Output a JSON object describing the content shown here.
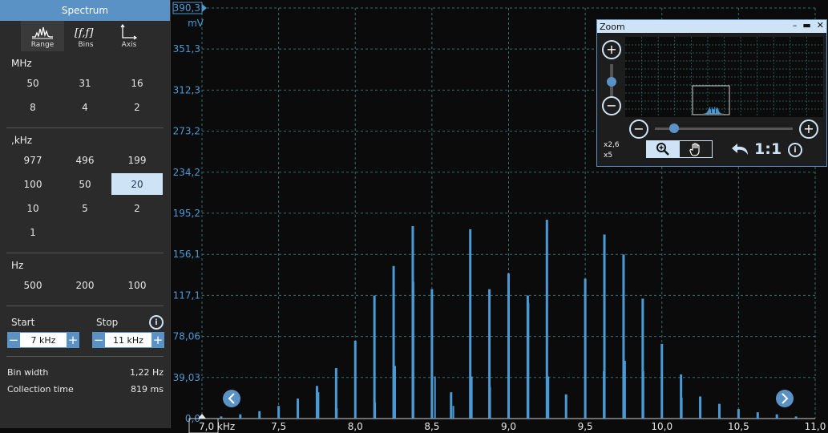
{
  "sidebar": {
    "title": "Spectrum",
    "tabs": [
      {
        "label": "Range",
        "icon": "spectrum-range-icon"
      },
      {
        "label": "Bins",
        "icon": "bins-icon"
      },
      {
        "label": "Axis",
        "icon": "axis-icon"
      }
    ],
    "sections": [
      {
        "label": "MHz",
        "values": [
          "50",
          "31",
          "16",
          "8",
          "4",
          "2"
        ]
      },
      {
        "label": ",kHz",
        "values": [
          "977",
          "496",
          "199",
          "100",
          "50",
          "20",
          "10",
          "5",
          "2",
          "1"
        ],
        "selected": "20"
      },
      {
        "label": "Hz",
        "values": [
          "500",
          "200",
          "100"
        ]
      }
    ],
    "start_label": "Start",
    "stop_label": "Stop",
    "start_value": "7 kHz",
    "stop_value": "11 kHz",
    "minus": "−",
    "plus": "+",
    "bin_width_label": "Bin width",
    "bin_width_value": "1,22 Hz",
    "collection_label": "Collection time",
    "collection_value": "819 ms"
  },
  "zoom": {
    "title": "Zoom",
    "x_factor": "x2,6",
    "y_factor": "x5",
    "ratio_label": "1:1",
    "info": "i"
  },
  "colors": {
    "accent": "#5b92c5",
    "selected_bg": "#cfe3f7",
    "grid": "#2f6f70",
    "trace": "#4a9ad6"
  },
  "chart_data": {
    "type": "bar",
    "ylabel": "mV",
    "xlabel": "kHz",
    "ylim": [
      0,
      390.3
    ],
    "xlim": [
      7.0,
      11.0
    ],
    "y_ticks": [
      "390,3",
      "351,3",
      "312,3",
      "273,2",
      "234,2",
      "195,2",
      "156,1",
      "117,1",
      "78,06",
      "39,03",
      "0,0"
    ],
    "y_tick_values": [
      390.3,
      351.3,
      312.3,
      273.2,
      234.2,
      195.2,
      156.1,
      117.1,
      78.06,
      39.03,
      0
    ],
    "x_ticks": [
      "7,0 kHz",
      "7,5",
      "8,0",
      "8,5",
      "9,0",
      "9,5",
      "10,0",
      "10,5",
      "11,0"
    ],
    "x_tick_values": [
      7.0,
      7.5,
      8.0,
      8.5,
      9.0,
      9.5,
      10.0,
      10.5,
      11.0
    ],
    "series": [
      {
        "values": [
          [
            7.125,
            2
          ],
          [
            7.25,
            4
          ],
          [
            7.375,
            7
          ],
          [
            7.5,
            12
          ],
          [
            7.625,
            19
          ],
          [
            7.75,
            31
          ],
          [
            7.875,
            48
          ],
          [
            8.0,
            74
          ],
          [
            8.125,
            117
          ],
          [
            8.25,
            145
          ],
          [
            8.375,
            183
          ],
          [
            8.5,
            123
          ],
          [
            8.625,
            25
          ],
          [
            8.75,
            180
          ],
          [
            8.875,
            123
          ],
          [
            9.0,
            138
          ],
          [
            9.125,
            117
          ],
          [
            9.25,
            189
          ],
          [
            9.375,
            23
          ],
          [
            9.5,
            133
          ],
          [
            9.625,
            175
          ],
          [
            9.75,
            156
          ],
          [
            9.875,
            114
          ],
          [
            10.0,
            71
          ],
          [
            10.125,
            42
          ],
          [
            10.25,
            21
          ],
          [
            10.375,
            14
          ],
          [
            10.5,
            9
          ],
          [
            10.625,
            6
          ],
          [
            10.75,
            4
          ],
          [
            10.875,
            2
          ]
        ]
      },
      {
        "values": [
          [
            7.76,
            25
          ],
          [
            7.88,
            10
          ],
          [
            8.0,
            60
          ],
          [
            8.13,
            15
          ],
          [
            8.26,
            50
          ],
          [
            8.38,
            130
          ],
          [
            8.52,
            40
          ],
          [
            8.64,
            12
          ],
          [
            8.76,
            40
          ],
          [
            8.88,
            30
          ],
          [
            9.0,
            40
          ],
          [
            9.13,
            110
          ],
          [
            9.26,
            40
          ],
          [
            9.5,
            85
          ],
          [
            9.62,
            45
          ],
          [
            9.76,
            55
          ],
          [
            9.88,
            45
          ],
          [
            10.0,
            40
          ],
          [
            10.13,
            20
          ],
          [
            10.25,
            15
          ]
        ]
      }
    ]
  }
}
